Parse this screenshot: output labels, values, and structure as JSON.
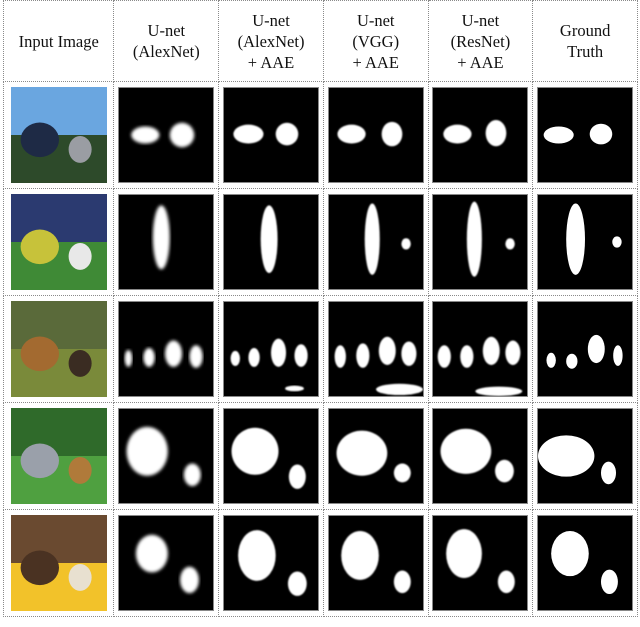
{
  "headers": [
    "Input Image",
    "U-net\n(AlexNet)",
    "U-net\n(AlexNet)\n+ AAE",
    "U-net\n(VGG)\n+ AAE",
    "U-net\n(ResNet)\n+ AAE",
    "Ground\nTruth"
  ],
  "rows": [
    {
      "input": "street-with-two-cars",
      "scene_colors": [
        "#6aa6e0",
        "#2d4a2a",
        "#9a9da3",
        "#1e2a45"
      ]
    },
    {
      "input": "soccer-player-kicking-ball",
      "scene_colors": [
        "#2b3a70",
        "#3f8a36",
        "#e8e8e8",
        "#c7c23a"
      ]
    },
    {
      "input": "turkeys-on-grass",
      "scene_colors": [
        "#5a6a3a",
        "#7a8a3a",
        "#3a2c22",
        "#a36a30"
      ]
    },
    {
      "input": "dog-and-cat-on-grass",
      "scene_colors": [
        "#2f6a2a",
        "#4fa040",
        "#b07a3a",
        "#9aa0aa"
      ]
    },
    {
      "input": "chick-and-eggshell-on-soil",
      "scene_colors": [
        "#6a4a30",
        "#f2c22a",
        "#e8e0d0",
        "#4a3222"
      ]
    }
  ]
}
